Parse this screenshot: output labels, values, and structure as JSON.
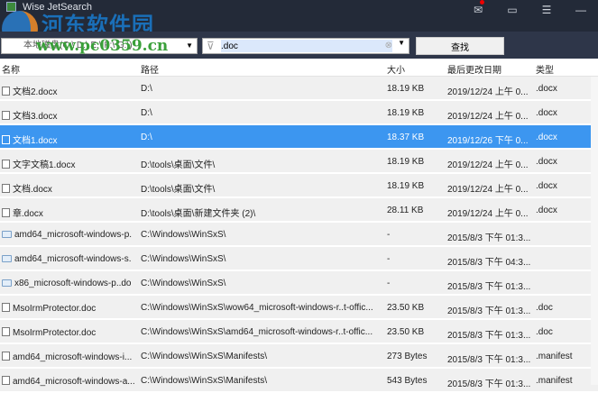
{
  "app": {
    "title": "Wise JetSearch",
    "watermark": "河东软件园",
    "watermark_url": "www.pc0359.cn"
  },
  "toolbar": {
    "drive": "本地磁盘(C:\\ D:\\ E:\\ F:\\ G:\\)",
    "filter_value": ".doc",
    "search_label": "查找"
  },
  "columns": [
    "名称",
    "路径",
    "大小",
    "最后更改日期",
    "类型"
  ],
  "rows": [
    {
      "icon": "file",
      "name": "文档2.docx",
      "path": "D:\\",
      "size": "18.19 KB",
      "date": "2019/12/24 上午 0...",
      "type": ".docx"
    },
    {
      "icon": "file",
      "name": "文档3.docx",
      "path": "D:\\",
      "size": "18.19 KB",
      "date": "2019/12/24 上午 0...",
      "type": ".docx"
    },
    {
      "icon": "file",
      "name": "文档1.docx",
      "path": "D:\\",
      "size": "18.37 KB",
      "date": "2019/12/26 下午 0...",
      "type": ".docx",
      "selected": true
    },
    {
      "icon": "file",
      "name": "文字文稿1.docx",
      "path": "D:\\tools\\桌面\\文件\\",
      "size": "18.19 KB",
      "date": "2019/12/24 上午 0...",
      "type": ".docx"
    },
    {
      "icon": "file",
      "name": "文档.docx",
      "path": "D:\\tools\\桌面\\文件\\",
      "size": "18.19 KB",
      "date": "2019/12/24 上午 0...",
      "type": ".docx"
    },
    {
      "icon": "file",
      "name": "章.docx",
      "path": "D:\\tools\\桌面\\新建文件夹 (2)\\",
      "size": "28.11 KB",
      "date": "2019/12/24 上午 0...",
      "type": ".docx"
    },
    {
      "icon": "folder",
      "name": "amd64_microsoft-windows-p.",
      "path": "C:\\Windows\\WinSxS\\",
      "size": "-",
      "date": "2015/8/3 下午 01:3...",
      "type": ""
    },
    {
      "icon": "folder",
      "name": "amd64_microsoft-windows-s.",
      "path": "C:\\Windows\\WinSxS\\",
      "size": "-",
      "date": "2015/8/3 下午 04:3...",
      "type": ""
    },
    {
      "icon": "folder",
      "name": "x86_microsoft-windows-p..do",
      "path": "C:\\Windows\\WinSxS\\",
      "size": "-",
      "date": "2015/8/3 下午 01:3...",
      "type": ""
    },
    {
      "icon": "file",
      "name": "MsoIrmProtector.doc",
      "path": "C:\\Windows\\WinSxS\\wow64_microsoft-windows-r..t-offic...",
      "size": "23.50 KB",
      "date": "2015/8/3 下午 01:3...",
      "type": ".doc"
    },
    {
      "icon": "file",
      "name": "MsoIrmProtector.doc",
      "path": "C:\\Windows\\WinSxS\\amd64_microsoft-windows-r..t-offic...",
      "size": "23.50 KB",
      "date": "2015/8/3 下午 01:3...",
      "type": ".doc"
    },
    {
      "icon": "file",
      "name": "amd64_microsoft-windows-i...",
      "path": "C:\\Windows\\WinSxS\\Manifests\\",
      "size": "273 Bytes",
      "date": "2015/8/3 下午 01:3...",
      "type": ".manifest"
    },
    {
      "icon": "file",
      "name": "amd64_microsoft-windows-a...",
      "path": "C:\\Windows\\WinSxS\\Manifests\\",
      "size": "543 Bytes",
      "date": "2015/8/3 下午 01:3...",
      "type": ".manifest"
    }
  ]
}
